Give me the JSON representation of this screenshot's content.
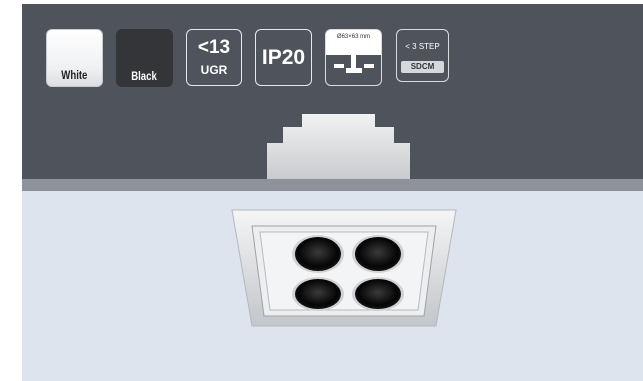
{
  "badges": {
    "white_label": "White",
    "black_label": "Black",
    "ugr_value": "<13",
    "ugr_label": "UGR",
    "ip_label": "IP20",
    "cutout_label": "Ø63×63 mm",
    "step_label": "< 3 STEP",
    "sdcm_label": "SDCM"
  },
  "colors": {
    "top_panel": "#4f535c",
    "bottom_panel": "#dde4ee",
    "finish_white": "#ffffff",
    "finish_black": "#333538"
  }
}
